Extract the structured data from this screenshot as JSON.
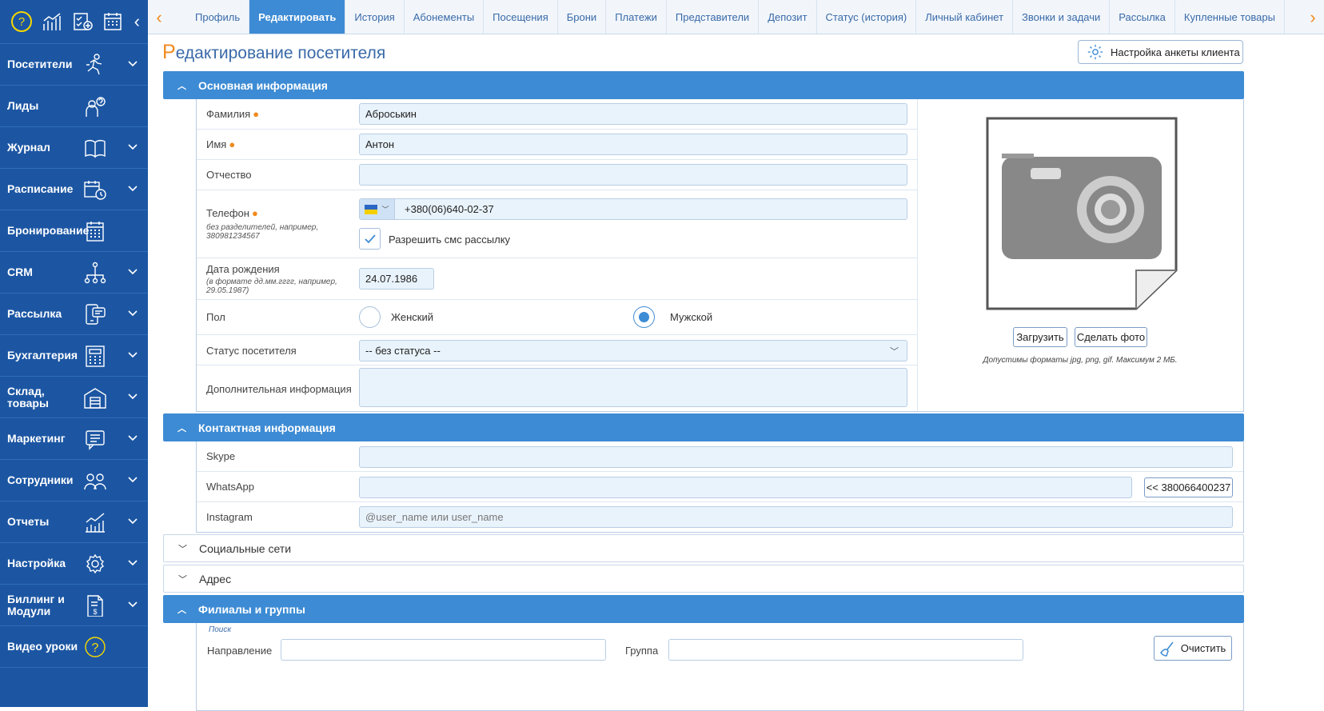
{
  "sidebar": {
    "items": [
      {
        "label": "Посетители",
        "icon": "running-person-icon",
        "dropdown": true
      },
      {
        "label": "Лиды",
        "icon": "person-question-icon",
        "dropdown": false
      },
      {
        "label": "Журнал",
        "icon": "book-icon",
        "dropdown": true
      },
      {
        "label": "Расписание",
        "icon": "calendar-clock-icon",
        "dropdown": true
      },
      {
        "label": "Бронирование",
        "icon": "calendar-grid-icon",
        "dropdown": false
      },
      {
        "label": "CRM",
        "icon": "org-chart-icon",
        "dropdown": true
      },
      {
        "label": "Рассылка",
        "icon": "phone-message-icon",
        "dropdown": true
      },
      {
        "label": "Бухгалтерия",
        "icon": "calculator-icon",
        "dropdown": true
      },
      {
        "label": "Склад, товары",
        "icon": "warehouse-icon",
        "dropdown": true
      },
      {
        "label": "Маркетинг",
        "icon": "chat-icon",
        "dropdown": true
      },
      {
        "label": "Сотрудники",
        "icon": "people-icon",
        "dropdown": true
      },
      {
        "label": "Отчеты",
        "icon": "report-chart-icon",
        "dropdown": true
      },
      {
        "label": "Настройка",
        "icon": "gear-icon",
        "dropdown": true
      },
      {
        "label": "Биллинг и Модули",
        "icon": "invoice-icon",
        "dropdown": true
      },
      {
        "label": "Видео уроки",
        "icon": "help-icon",
        "dropdown": false
      }
    ]
  },
  "tabs": [
    "Профиль",
    "Редактировать",
    "История",
    "Абонементы",
    "Посещения",
    "Брони",
    "Платежи",
    "Представители",
    "Депозит",
    "Статус (история)",
    "Личный кабинет",
    "Звонки и задачи",
    "Рассылка",
    "Купленные товары"
  ],
  "active_tab": "Редактировать",
  "page": {
    "title_first": "Р",
    "title_rest": "едактирование посетителя",
    "config_button": "Настройка анкеты клиента"
  },
  "basic": {
    "header": "Основная информация",
    "lastname_label": "Фамилия",
    "lastname_value": "Аброськин",
    "firstname_label": "Имя",
    "firstname_value": "Антон",
    "middlename_label": "Отчество",
    "middlename_value": "",
    "phone_label": "Телефон",
    "phone_hint": "без разделителей, например, 380981234567",
    "phone_value": "+380(06)640-02-37",
    "sms_label": "Разрешить смс рассылку",
    "birth_label": "Дата рождения",
    "birth_hint": "(в формате дд.мм.гггг, например, 29.05.1987)",
    "birth_value": "24.07.1986",
    "gender_label": "Пол",
    "gender_female": "Женский",
    "gender_male": "Мужской",
    "status_label": "Статус посетителя",
    "status_value": "-- без статуса --",
    "extra_label": "Дополнительная информация",
    "upload_btn": "Загрузить",
    "photo_btn": "Сделать фото",
    "photo_hint": "Допустимы форматы jpg, png, gif. Максимум 2 МБ."
  },
  "contact": {
    "header": "Контактная информация",
    "skype_label": "Skype",
    "whatsapp_label": "WhatsApp",
    "whatsapp_btn": "<< 380066400237",
    "instagram_label": "Instagram",
    "instagram_placeholder": "@user_name или user_name"
  },
  "social": {
    "header": "Социальные сети"
  },
  "address": {
    "header": "Адрес"
  },
  "branches": {
    "header": "Филиалы и группы",
    "search_label": "Поиск",
    "direction_label": "Направление",
    "group_label": "Группа",
    "clear_btn": "Очистить"
  },
  "colors": {
    "accent": "#3d8bd4",
    "sidebar": "#1c56a3",
    "orange": "#f08a1e"
  }
}
